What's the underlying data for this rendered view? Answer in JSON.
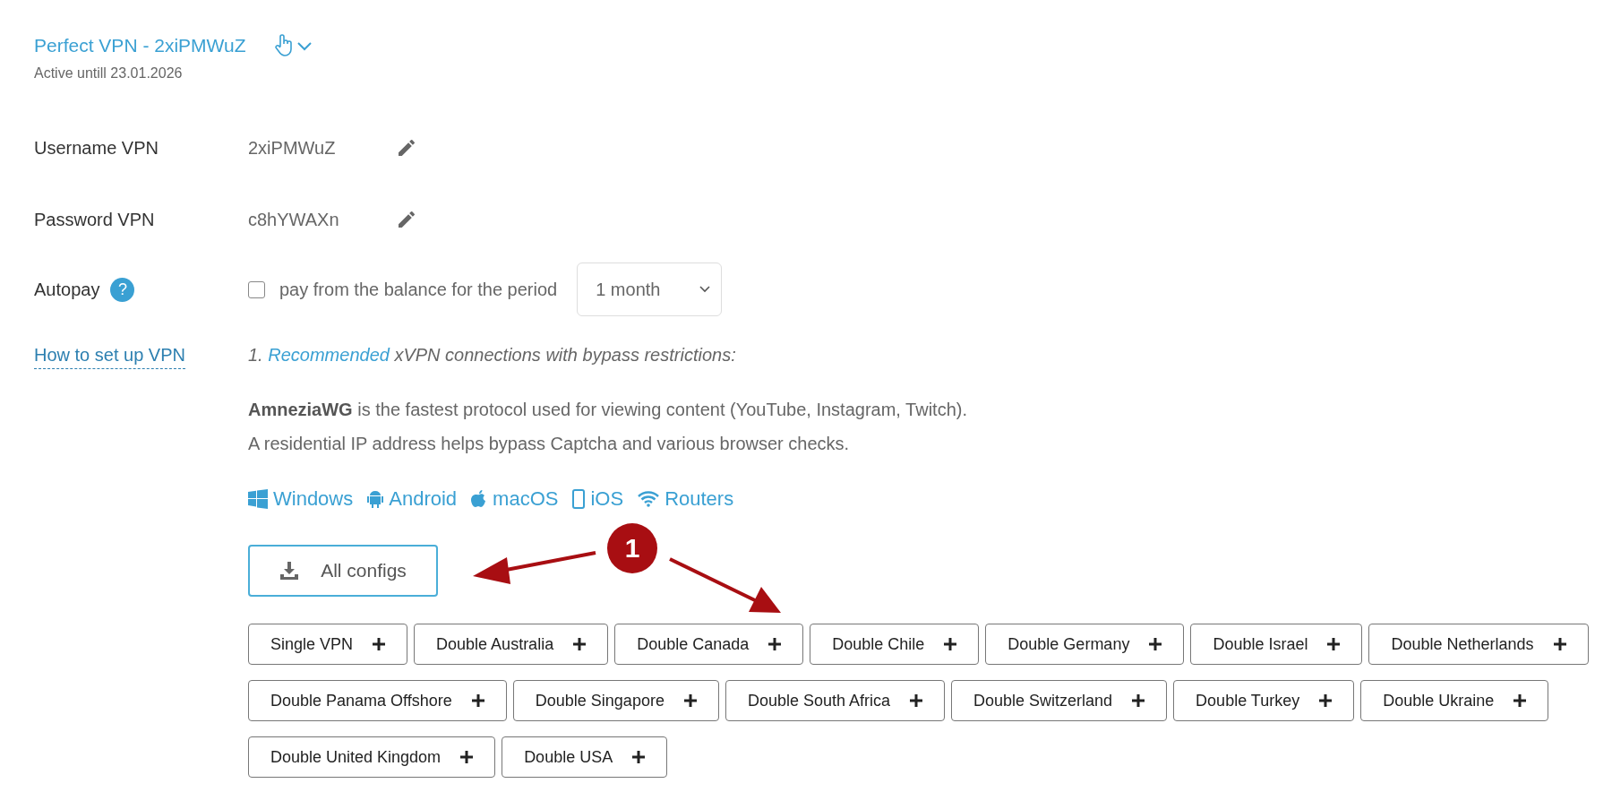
{
  "header": {
    "title": "Perfect VPN - 2xiPMWuZ",
    "subtitle": "Active untill 23.01.2026"
  },
  "fields": [
    {
      "label": "Username VPN",
      "value": "2xiPMWuZ"
    },
    {
      "label": "Password VPN",
      "value": "c8hYWAXn"
    }
  ],
  "autopay": {
    "label": "Autopay",
    "help": "?",
    "checked": false,
    "checkbox_label": "pay from the balance for the period",
    "period": "1 month"
  },
  "setup": {
    "link": "How to set up VPN",
    "intro": [
      {
        "text": "1. ",
        "highlight": false
      },
      {
        "text": "Recommended",
        "highlight": true
      },
      {
        "text": " xVPN connections with bypass restrictions:",
        "highlight": false
      }
    ],
    "description": [
      "**AmneziaWG** is the fastest protocol used for viewing content (YouTube, Instagram, Twitch).",
      "A residential IP address helps bypass Captcha and various browser checks."
    ],
    "platforms": [
      {
        "kind": "windows",
        "label": "Windows"
      },
      {
        "kind": "android",
        "label": "Android"
      },
      {
        "kind": "apple",
        "label": "macOS"
      },
      {
        "kind": "phone",
        "label": "iOS"
      },
      {
        "kind": "wifi",
        "label": "Routers"
      }
    ],
    "all_configs": "All configs",
    "config_rows": [
      [
        "Single VPN",
        "Double Australia",
        "Double Canada",
        "Double Chile",
        "Double Germany",
        "Double Israel",
        "Double Netherlands"
      ],
      [
        "Double Panama Offshore",
        "Double Singapore",
        "Double South Africa",
        "Double Switzerland",
        "Double Turkey",
        "Double Ukraine"
      ],
      [
        "Double United Kingdom",
        "Double USA"
      ]
    ]
  },
  "annotation": {
    "marker": "1"
  }
}
